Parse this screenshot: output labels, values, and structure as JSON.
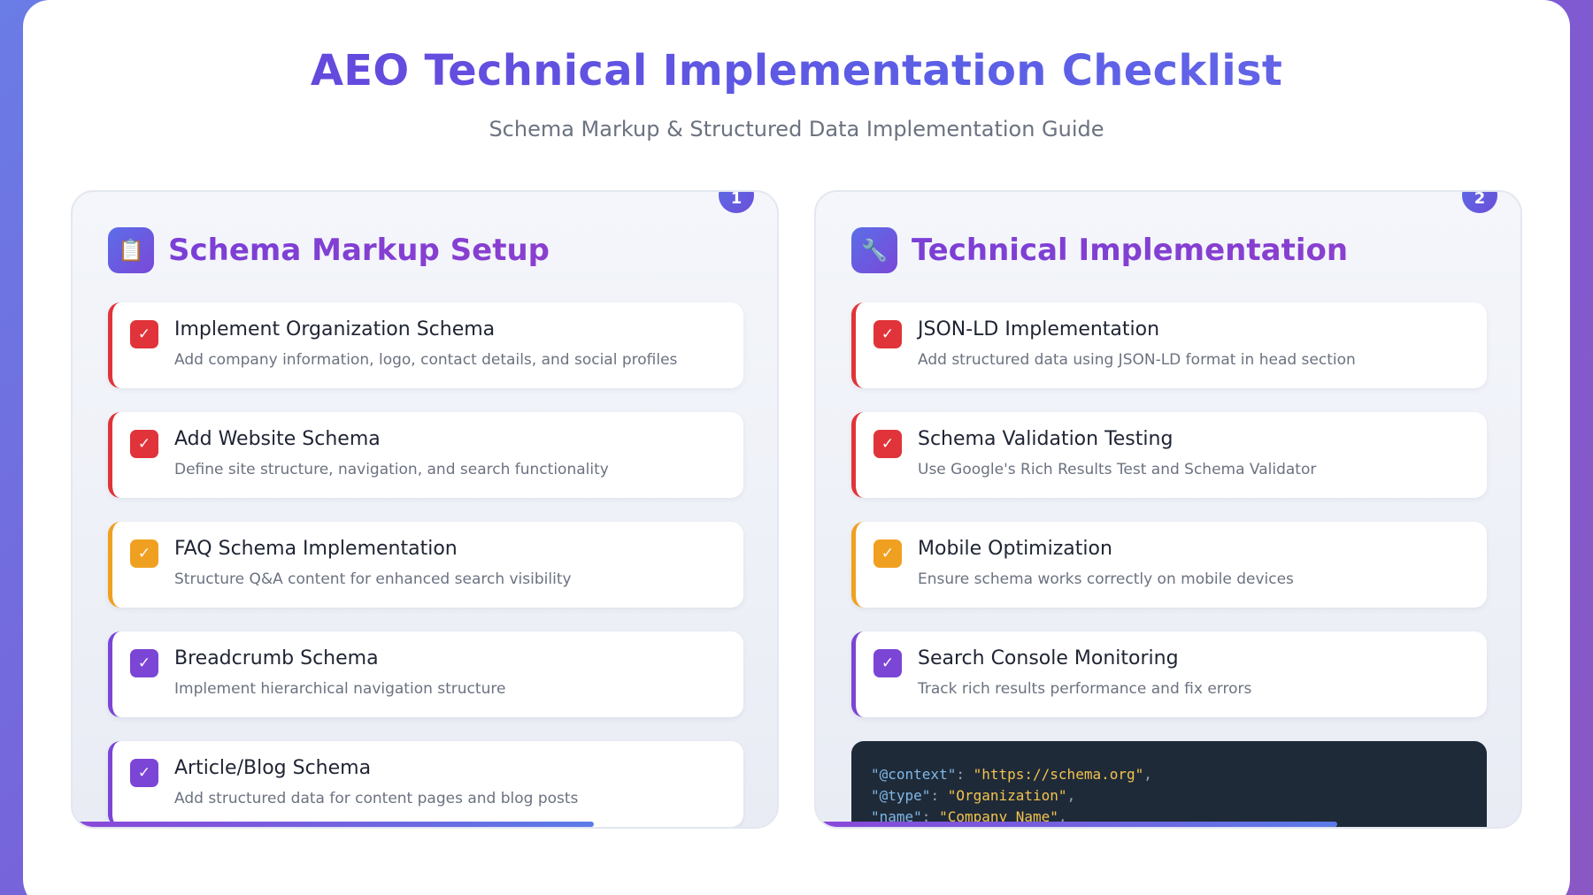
{
  "page": {
    "title": "AEO Technical Implementation Checklist",
    "subtitle": "Schema Markup & Structured Data Implementation Guide"
  },
  "panels": [
    {
      "number": "1",
      "icon": "clipboard-icon",
      "heading": "Schema Markup Setup",
      "progress_percent": 74,
      "items": [
        {
          "title": "Implement Organization Schema",
          "desc": "Add company information, logo, contact details, and social profiles",
          "status": "red"
        },
        {
          "title": "Add Website Schema",
          "desc": "Define site structure, navigation, and search functionality",
          "status": "red"
        },
        {
          "title": "FAQ Schema Implementation",
          "desc": "Structure Q&A content for enhanced search visibility",
          "status": "orange"
        },
        {
          "title": "Breadcrumb Schema",
          "desc": "Implement hierarchical navigation structure",
          "status": "purple"
        },
        {
          "title": "Article/Blog Schema",
          "desc": "Add structured data for content pages and blog posts",
          "status": "purple"
        }
      ]
    },
    {
      "number": "2",
      "icon": "wrench-icon",
      "heading": "Technical Implementation",
      "progress_percent": 74,
      "items": [
        {
          "title": "JSON-LD Implementation",
          "desc": "Add structured data using JSON-LD format in head section",
          "status": "red"
        },
        {
          "title": "Schema Validation Testing",
          "desc": "Use Google's Rich Results Test and Schema Validator",
          "status": "red"
        },
        {
          "title": "Mobile Optimization",
          "desc": "Ensure schema works correctly on mobile devices",
          "status": "orange"
        },
        {
          "title": "Search Console Monitoring",
          "desc": "Track rich results performance and fix errors",
          "status": "purple"
        }
      ],
      "code": {
        "lines": [
          {
            "key": "\"@context\"",
            "value": "\"https://schema.org\""
          },
          {
            "key": "\"@type\"",
            "value": "\"Organization\""
          },
          {
            "key": "\"name\"",
            "value": "\"Company Name\""
          }
        ]
      }
    }
  ],
  "check_glyph": "✓",
  "colors": {
    "red": "#e0343a",
    "orange": "#f0a020",
    "purple": "#7b45d6",
    "accent": "#5b5fe6"
  }
}
